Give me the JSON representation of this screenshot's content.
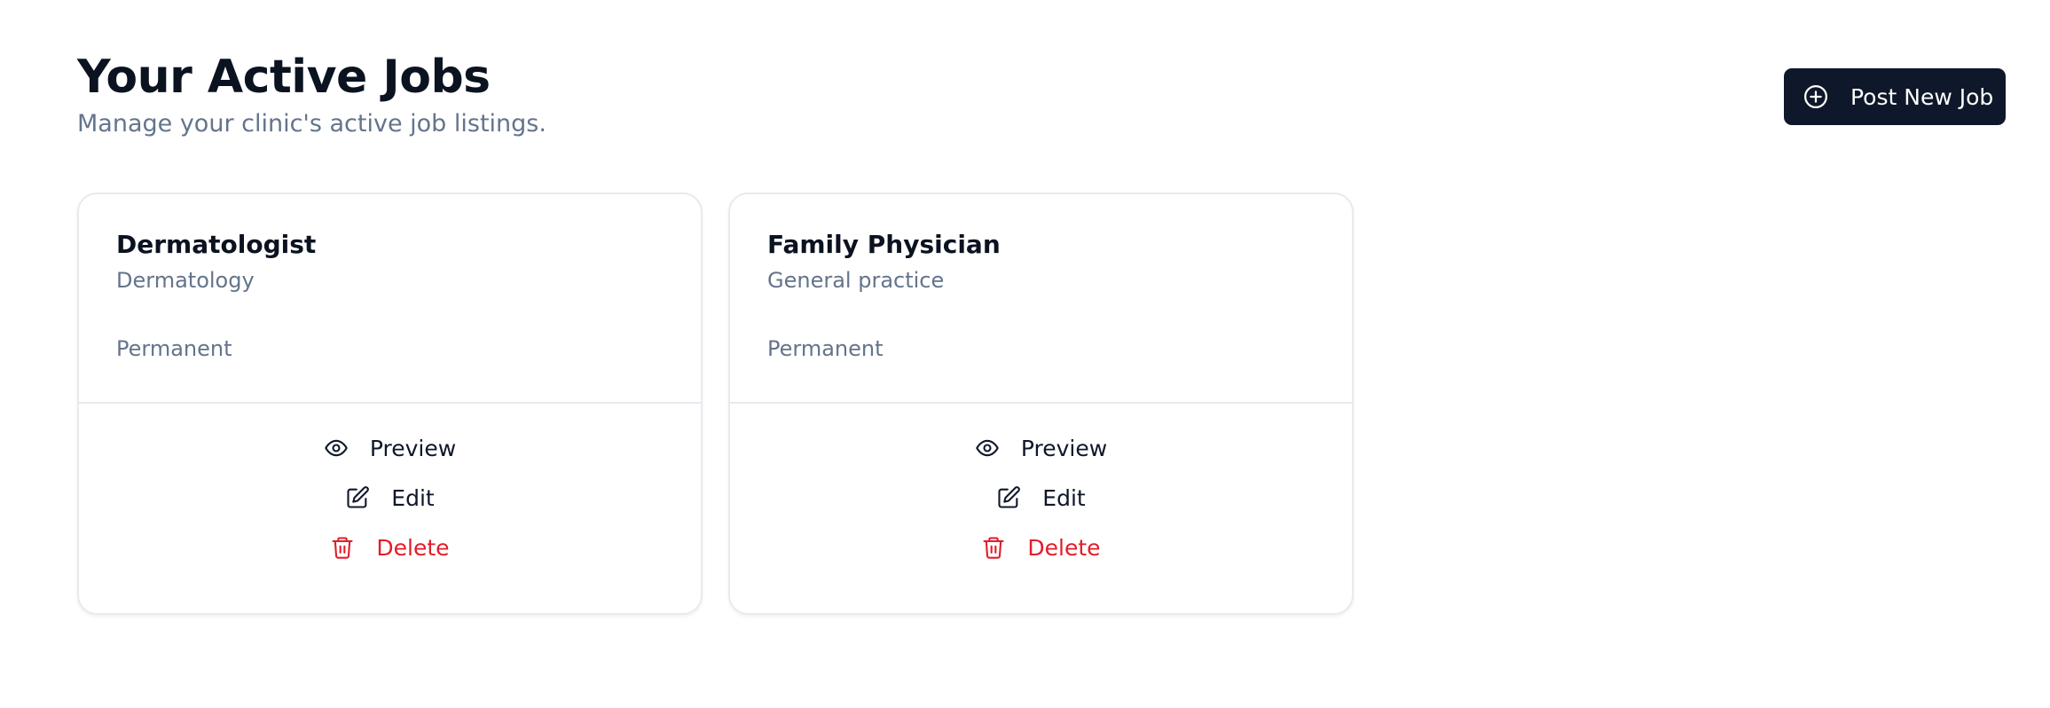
{
  "header": {
    "title": "Your Active Jobs",
    "subtitle": "Manage your clinic's active job listings."
  },
  "toolbar": {
    "post_label": "Post New Job",
    "post_icon": "plus-circle-icon"
  },
  "jobs": [
    {
      "title": "Dermatologist",
      "specialty": "Dermatology",
      "type": "Permanent",
      "actions": {
        "preview": "Preview",
        "edit": "Edit",
        "delete": "Delete"
      }
    },
    {
      "title": "Family Physician",
      "specialty": "General practice",
      "type": "Permanent",
      "actions": {
        "preview": "Preview",
        "edit": "Edit",
        "delete": "Delete"
      }
    }
  ],
  "colors": {
    "primary": "#0f172a",
    "muted": "#64748b",
    "danger": "#e11d2a",
    "border": "#e7eaef"
  }
}
